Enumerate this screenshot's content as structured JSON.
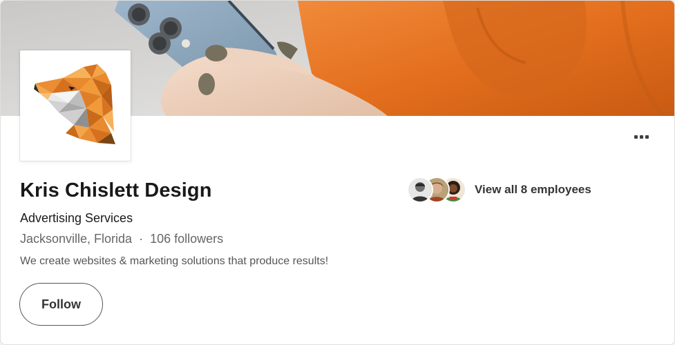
{
  "company": {
    "name": "Kris Chislett Design",
    "industry": "Advertising Services",
    "location": "Jacksonville, Florida",
    "separator": "·",
    "followers": "106 followers",
    "tagline": "We create websites & marketing solutions that produce results!"
  },
  "actions": {
    "follow_label": "Follow",
    "employees_label": "View all 8 employees"
  },
  "icons": {
    "more": "more-horizontal-icon",
    "logo": "geometric-fox-logo"
  },
  "colors": {
    "cover_orange": "#e36f1e",
    "logo_orange": "#e8902f",
    "border_dark": "#555555"
  }
}
